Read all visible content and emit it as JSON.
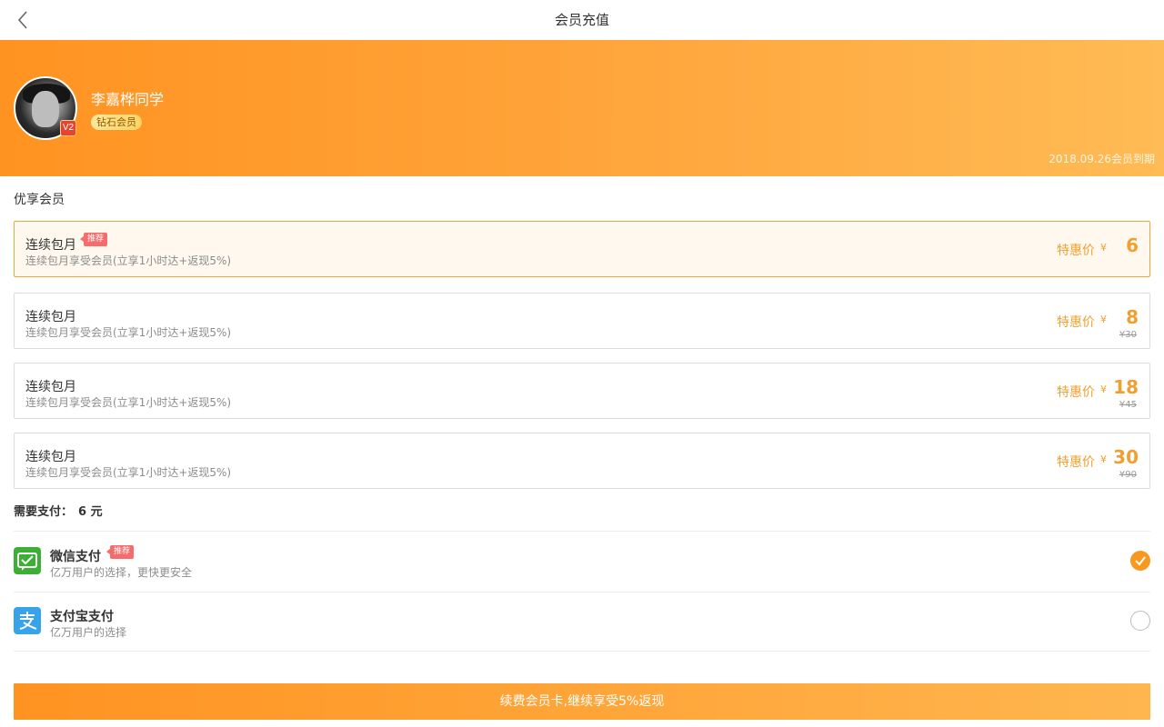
{
  "nav": {
    "title": "会员充值"
  },
  "user": {
    "name": "李嘉桦同学",
    "vip_badge": "V2",
    "level": "钻石会员",
    "expire_text": "2018.09.26会员到期"
  },
  "section_title": "优享会员",
  "plans": [
    {
      "name": "连续包月",
      "desc": "连续包月享受会员(立享1小时达+返现5%)",
      "tag": "推荐",
      "price_label": "特惠价",
      "currency": "¥",
      "price": "6",
      "original": "",
      "selected": true
    },
    {
      "name": "连续包月",
      "desc": "连续包月享受会员(立享1小时达+返现5%)",
      "tag": "",
      "price_label": "特惠价",
      "currency": "¥",
      "price": "8",
      "original": "¥30",
      "selected": false
    },
    {
      "name": "连续包月",
      "desc": "连续包月享受会员(立享1小时达+返现5%)",
      "tag": "",
      "price_label": "特惠价",
      "currency": "¥",
      "price": "18",
      "original": "¥45",
      "selected": false
    },
    {
      "name": "连续包月",
      "desc": "连续包月享受会员(立享1小时达+返现5%)",
      "tag": "",
      "price_label": "特惠价",
      "currency": "¥",
      "price": "30",
      "original": "¥90",
      "selected": false
    }
  ],
  "pay_summary": {
    "label": "需要支付：",
    "amount": "6 元"
  },
  "payments": [
    {
      "name": "微信支付",
      "tag": "推荐",
      "desc": "亿万用户的选择，更快更安全",
      "icon": "wechat-pay-icon",
      "checked": true
    },
    {
      "name": "支付宝支付",
      "tag": "",
      "desc": "亿万用户的选择",
      "icon": "alipay-icon",
      "checked": false
    }
  ],
  "submit_label": "续费会员卡,继续享受5%返现",
  "colors": {
    "accent": "#ff9321",
    "price": "#f0a030",
    "tag": "#f56c6c",
    "wechat": "#3cb034",
    "alipay": "#36a3ea"
  }
}
